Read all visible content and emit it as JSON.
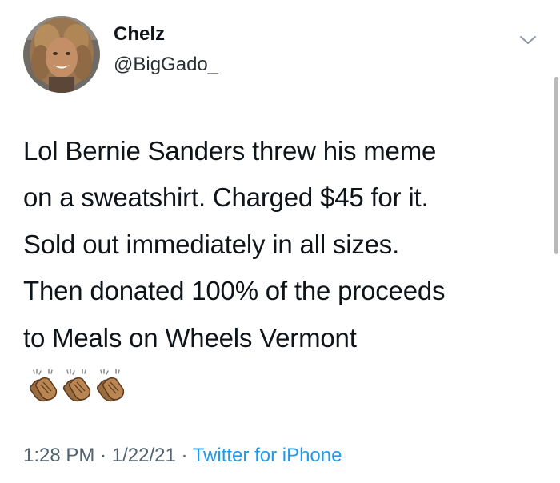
{
  "tweet": {
    "author": {
      "display_name": "Chelz",
      "handle": "@BigGado_"
    },
    "text_lines": [
      "Lol Bernie Sanders threw his meme",
      "on a sweatshirt. Charged $45 for it.",
      "Sold out immediately in all sizes.",
      "Then donated 100% of the proceeds",
      "to Meals on Wheels Vermont"
    ],
    "emoji": [
      "clapping-hands-icon",
      "clapping-hands-icon",
      "clapping-hands-icon"
    ],
    "time": "1:28 PM",
    "separator": "·",
    "date": "1/22/21",
    "source": "Twitter for iPhone"
  },
  "colors": {
    "text": "#0f1419",
    "secondary": "#536471",
    "link": "#1d9bf0",
    "background": "#ffffff"
  }
}
